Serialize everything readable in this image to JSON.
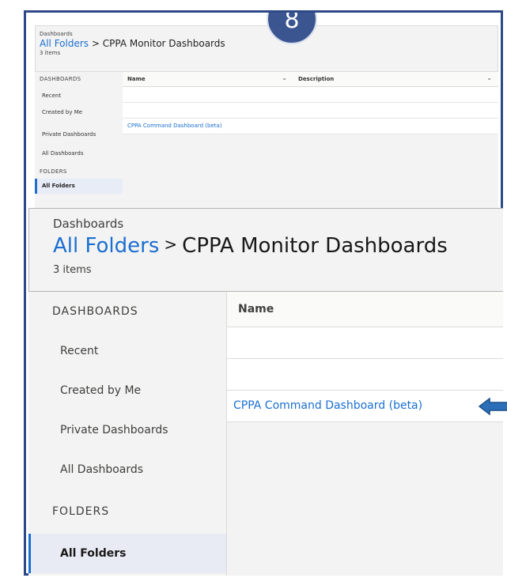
{
  "badge": "8",
  "small_view": {
    "eyebrow": "Dashboards",
    "breadcrumb_link": "All Folders",
    "breadcrumb_separator": ">",
    "breadcrumb_current": "CPPA Monitor Dashboards",
    "item_count": "3 items",
    "sidebar": {
      "dashboards_header": "DASHBOARDS",
      "items": [
        "Recent",
        "Created by Me",
        "Private Dashboards",
        "All Dashboards"
      ],
      "folders_header": "FOLDERS",
      "selected": "All Folders"
    },
    "table": {
      "columns": [
        "Name",
        "Description"
      ],
      "rows": [
        "",
        "",
        "CPPA Command Dashboard (beta)"
      ]
    }
  },
  "zoom_view": {
    "eyebrow": "Dashboards",
    "breadcrumb_link": "All Folders",
    "breadcrumb_separator": ">",
    "breadcrumb_current": "CPPA Monitor Dashboards",
    "item_count": "3 items",
    "sidebar": {
      "dashboards_header": "DASHBOARDS",
      "items": [
        "Recent",
        "Created by Me",
        "Private Dashboards",
        "All Dashboards"
      ],
      "folders_header": "FOLDERS",
      "selected": "All Folders"
    },
    "table": {
      "columns": [
        "Name"
      ],
      "rows": [
        "",
        "",
        "CPPA Command Dashboard (beta)"
      ]
    }
  },
  "colors": {
    "frame": "#2e4a86",
    "link": "#1b6fd1",
    "callout_arrow": "#2a6fb8"
  }
}
